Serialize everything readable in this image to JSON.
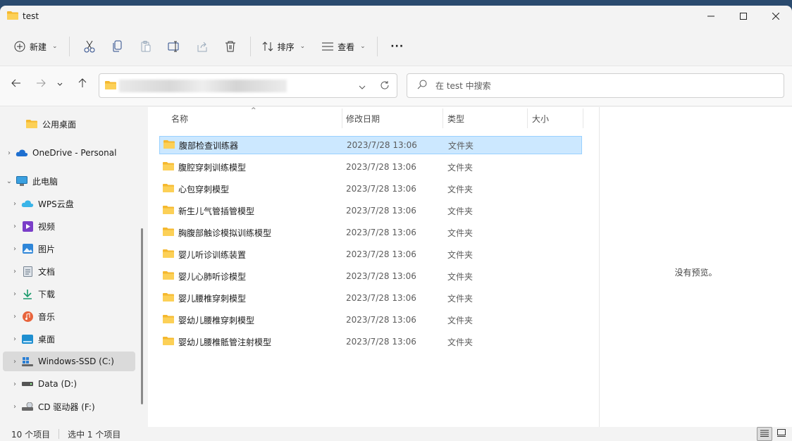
{
  "window": {
    "title": "test"
  },
  "toolbar": {
    "new_label": "新建",
    "sort_label": "排序",
    "view_label": "查看",
    "more_label": "···"
  },
  "search": {
    "placeholder": "在 test 中搜索"
  },
  "sidebar": {
    "items": [
      {
        "label": "公用桌面",
        "icon": "folder-icon"
      },
      {
        "label": "OneDrive - Personal",
        "icon": "cloud-icon"
      },
      {
        "label": "此电脑",
        "icon": "computer-icon"
      },
      {
        "label": "WPS云盘",
        "icon": "wps-cloud-icon"
      },
      {
        "label": "视频",
        "icon": "video-icon"
      },
      {
        "label": "图片",
        "icon": "picture-icon"
      },
      {
        "label": "文档",
        "icon": "document-icon"
      },
      {
        "label": "下载",
        "icon": "download-icon"
      },
      {
        "label": "音乐",
        "icon": "music-icon"
      },
      {
        "label": "桌面",
        "icon": "desktop-icon"
      },
      {
        "label": "Windows-SSD (C:)",
        "icon": "windows-drive-icon"
      },
      {
        "label": "Data (D:)",
        "icon": "drive-icon"
      },
      {
        "label": "CD 驱动器 (F:)",
        "icon": "cd-drive-icon"
      }
    ]
  },
  "columns": {
    "name": "名称",
    "date": "修改日期",
    "type": "类型",
    "size": "大小"
  },
  "files": [
    {
      "name": "腹部检查训练器",
      "date": "2023/7/28 13:06",
      "type": "文件夹"
    },
    {
      "name": "腹腔穿刺训练模型",
      "date": "2023/7/28 13:06",
      "type": "文件夹"
    },
    {
      "name": "心包穿刺模型",
      "date": "2023/7/28 13:06",
      "type": "文件夹"
    },
    {
      "name": "新生儿气管插管模型",
      "date": "2023/7/28 13:06",
      "type": "文件夹"
    },
    {
      "name": "胸腹部触诊模拟训练模型",
      "date": "2023/7/28 13:06",
      "type": "文件夹"
    },
    {
      "name": "婴儿听诊训练装置",
      "date": "2023/7/28 13:06",
      "type": "文件夹"
    },
    {
      "name": "婴儿心肺听诊模型",
      "date": "2023/7/28 13:06",
      "type": "文件夹"
    },
    {
      "name": "婴儿腰椎穿刺模型",
      "date": "2023/7/28 13:06",
      "type": "文件夹"
    },
    {
      "name": "婴幼儿腰椎穿刺模型",
      "date": "2023/7/28 13:06",
      "type": "文件夹"
    },
    {
      "name": "婴幼儿腰椎骶管注射模型",
      "date": "2023/7/28 13:06",
      "type": "文件夹"
    }
  ],
  "preview": {
    "text": "没有预览。"
  },
  "status": {
    "count": "10 个项目",
    "selected": "选中 1 个项目"
  },
  "colors": {
    "accent": "#cce8ff",
    "folder": "#f8c73f"
  }
}
